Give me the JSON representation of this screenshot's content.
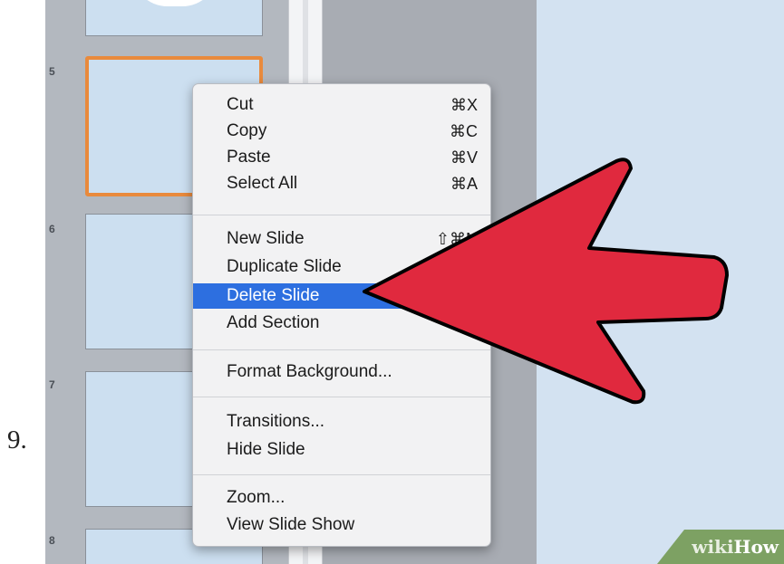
{
  "step_number": "9.",
  "thumbnails": [
    {
      "number": "",
      "kind": "pie-chart-slide"
    },
    {
      "number": "5",
      "selected": true
    },
    {
      "number": "6"
    },
    {
      "number": "7"
    },
    {
      "number": "8"
    }
  ],
  "context_menu": {
    "groups": [
      [
        {
          "label": "Cut",
          "shortcut": "⌘X"
        },
        {
          "label": "Copy",
          "shortcut": "⌘C"
        },
        {
          "label": "Paste",
          "shortcut": "⌘V"
        },
        {
          "label": "Select All",
          "shortcut": "⌘A"
        }
      ],
      [
        {
          "label": "New Slide",
          "shortcut": "⇧⌘N"
        },
        {
          "label": "Duplicate Slide",
          "shortcut": ""
        },
        {
          "label": "Delete Slide",
          "shortcut": "",
          "highlighted": true
        },
        {
          "label": "Add Section",
          "shortcut": ""
        }
      ],
      [
        {
          "label": "Format Background...",
          "shortcut": ""
        }
      ],
      [
        {
          "label": "Transitions...",
          "shortcut": ""
        },
        {
          "label": "Hide Slide",
          "shortcut": ""
        }
      ],
      [
        {
          "label": "Zoom...",
          "shortcut": ""
        },
        {
          "label": "View Slide Show",
          "shortcut": ""
        }
      ]
    ]
  },
  "annotation": {
    "shape": "arrow-pointing-left",
    "fill": "#e0293e",
    "outline": "#000000"
  },
  "watermark": {
    "wiki": "wiki",
    "how": "How",
    "background": "#7da163"
  },
  "colors": {
    "highlight": "#2d6fe0",
    "selected_border": "#e98a3c",
    "slide_fill": "#ccdff0"
  }
}
